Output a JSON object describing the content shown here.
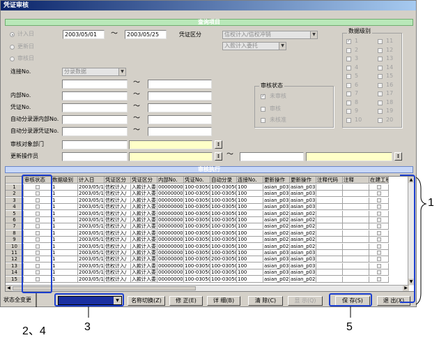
{
  "window": {
    "title": "凭证审核"
  },
  "query": {
    "band": "查询项目",
    "date_radios": [
      {
        "label": "计入日",
        "selected": true
      },
      {
        "label": "更新日",
        "selected": false
      },
      {
        "label": "审核日",
        "selected": false
      }
    ],
    "date_from": "2003/05/01",
    "date_sep": "〜",
    "date_to": "2003/05/25",
    "voucher_type_label": "凭证区分",
    "voucher_type_value": "信权计入/信权冲销",
    "voucher_sub_value": "入款计入委托",
    "link_label": "连接No.",
    "link_value": "分录数据",
    "range_sep": "〜",
    "internal_label": "内部No.",
    "voucher_no_label": "凭证No.",
    "auto_internal_label": "自动分录源内部No.",
    "auto_voucher_label": "自动分录源凭证No.",
    "dept_label": "审核对象部门",
    "operator_label": "更新操作员",
    "lookup_btn": "↕"
  },
  "audit_status": {
    "title": "审核状态",
    "items": [
      {
        "label": "未审核",
        "checked": true
      },
      {
        "label": "审核",
        "checked": false
      },
      {
        "label": "未核准",
        "checked": false
      }
    ]
  },
  "data_level": {
    "title": "数据级别",
    "col1": [
      "1",
      "2",
      "3",
      "4",
      "5",
      "6",
      "7",
      "8",
      "9",
      "10"
    ],
    "col2": [
      "11",
      "12",
      "13",
      "14",
      "15",
      "16",
      "17",
      "18",
      "19",
      "20"
    ]
  },
  "results": {
    "band": "审核执行",
    "columns": [
      "审核状态",
      "数据级别",
      "计入日",
      "凭证区分",
      "凭证区分",
      "内部No.",
      "凭证No.",
      "自动分录",
      "连接No.",
      "更新操作",
      "更新操作",
      "注释代码",
      "注释",
      "在建工程"
    ],
    "rows": [
      {
        "n": "1",
        "level": "1",
        "date": "2003/05/1",
        "t1": "信权计入/",
        "t2": "入款计入委",
        "internal": "000000000",
        "voucher": "100-03050",
        "auto": "100-03050",
        "link": "100",
        "u1": "asian_p03",
        "u2": "asian_p03"
      },
      {
        "n": "2",
        "level": "1",
        "date": "2003/05/1",
        "t1": "信权计入/",
        "t2": "入款计入委",
        "internal": "000000000",
        "voucher": "100-03050",
        "auto": "100-03050",
        "link": "100",
        "u1": "asian_p03",
        "u2": "asian_p03"
      },
      {
        "n": "3",
        "level": "1",
        "date": "2003/05/1",
        "t1": "信权计入/",
        "t2": "入款计入委",
        "internal": "000000000",
        "voucher": "100-03050",
        "auto": "100-03050",
        "link": "100",
        "u1": "asian_p03",
        "u2": "asian_p03"
      },
      {
        "n": "4",
        "level": "1",
        "date": "2003/05/1",
        "t1": "信权计入/",
        "t2": "入款计入委",
        "internal": "000000000",
        "voucher": "100-03050",
        "auto": "100-03050",
        "link": "100",
        "u1": "asian_p03",
        "u2": "asian_p03"
      },
      {
        "n": "5",
        "level": "1",
        "date": "2003/05/1",
        "t1": "信权计入/",
        "t2": "入款计入委",
        "internal": "000000000",
        "voucher": "100-03050",
        "auto": "100-03050",
        "link": "100",
        "u1": "asian_p02",
        "u2": "asian_p02"
      },
      {
        "n": "6",
        "level": "1",
        "date": "2003/05/1",
        "t1": "信权计入/",
        "t2": "入款计入委",
        "internal": "000000000",
        "voucher": "100-03050",
        "auto": "100-03050",
        "link": "100",
        "u1": "asian_p02",
        "u2": "asian_p02"
      },
      {
        "n": "7",
        "level": "1",
        "date": "2003/05/1",
        "t1": "信权计入/",
        "t2": "入款计入委",
        "internal": "000000000",
        "voucher": "100-03050",
        "auto": "100-03050",
        "link": "100",
        "u1": "asian_p02",
        "u2": "asian_p02"
      },
      {
        "n": "8",
        "level": "1",
        "date": "2003/05/1",
        "t1": "信权计入/",
        "t2": "入款计入委",
        "internal": "000000000",
        "voucher": "100-03050",
        "auto": "100-03050",
        "link": "100",
        "u1": "asian_p02",
        "u2": "asian_p02"
      },
      {
        "n": "9",
        "level": "1",
        "date": "2003/05/1",
        "t1": "信权计入/",
        "t2": "入款计入委",
        "internal": "000000000",
        "voucher": "100-03050",
        "auto": "100-03050",
        "link": "100",
        "u1": "asian_p02",
        "u2": "asian_p02"
      },
      {
        "n": "10",
        "level": "1",
        "date": "2003/05/1",
        "t1": "信权计入/",
        "t2": "入款计入委",
        "internal": "000000000",
        "voucher": "100-03050",
        "auto": "100-03050",
        "link": "100",
        "u1": "asian_p02",
        "u2": "asian_p02"
      },
      {
        "n": "11",
        "level": "1",
        "date": "2003/05/1",
        "t1": "信权计入/",
        "t2": "入款计入委",
        "internal": "000000000",
        "voucher": "100-03050",
        "auto": "100-03050",
        "link": "100",
        "u1": "asian_p03",
        "u2": "asian_p03"
      },
      {
        "n": "12",
        "level": "1",
        "date": "2003/05/1",
        "t1": "信权计入/",
        "t2": "入款计入委",
        "internal": "000000000",
        "voucher": "100-03050",
        "auto": "200-03050",
        "link": "100",
        "u1": "asian_p03",
        "u2": "asian_p03"
      },
      {
        "n": "13",
        "level": "1",
        "date": "2003/05/1",
        "t1": "信权计入/",
        "t2": "入款计入委",
        "internal": "000000000",
        "voucher": "100-03050",
        "auto": "100-03050",
        "link": "100",
        "u1": "asian_p03",
        "u2": "asian_p03"
      },
      {
        "n": "14",
        "level": "1",
        "date": "2003/05/1",
        "t1": "信权计入/",
        "t2": "入款计入委",
        "internal": "000000000",
        "voucher": "100-03050",
        "auto": "100-03050",
        "link": "100",
        "u1": "asian_p03",
        "u2": "asian_p03"
      },
      {
        "n": "15",
        "level": "1",
        "date": "2003/05/1",
        "t1": "信权计入/",
        "t2": "入款计入委",
        "internal": "000000000",
        "voucher": "100-03050",
        "auto": "100-03050",
        "link": "100",
        "u1": "asian_p02",
        "u2": "asian_p02"
      }
    ]
  },
  "footer": {
    "status_change_label": "状态全变更",
    "buttons": [
      {
        "label": "名称切换(Z)",
        "enabled": true
      },
      {
        "label": "修 正(E)",
        "enabled": true
      },
      {
        "label": "详 细(B)",
        "enabled": true
      },
      {
        "label": "清 除(C)",
        "enabled": true
      },
      {
        "label": "显 示(Q)",
        "enabled": false
      },
      {
        "label": "保 存(S)",
        "enabled": true
      },
      {
        "label": "退 出(X)",
        "enabled": true
      }
    ]
  },
  "callouts": {
    "c1": "1",
    "c2": "2、4",
    "c3": "3",
    "c5": "5"
  },
  "colors": {
    "callout_blue": "#1c3fd0",
    "band_green": "#b9e8b9",
    "band_blue": "#c8d8f8"
  }
}
